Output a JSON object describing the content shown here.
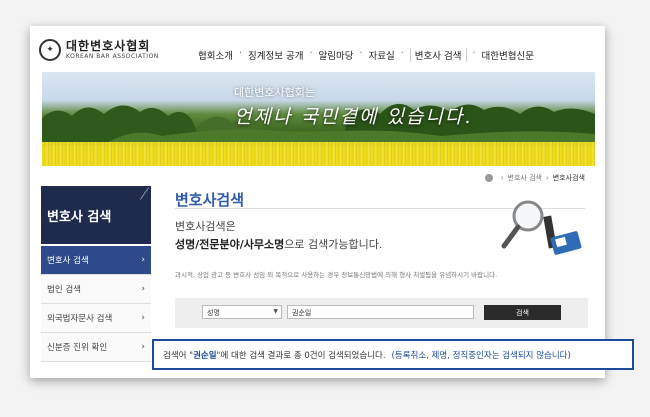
{
  "header": {
    "logo_seal": "✦",
    "logo_ko": "대한변호사협회",
    "logo_en": "KOREAN BAR ASSOCIATION",
    "nav": [
      "협회소개",
      "징계정보 공개",
      "알림마당",
      "자료실",
      "변호사 검색",
      "대한변협신문"
    ]
  },
  "banner": {
    "line1": "대한변호사협회는",
    "line2": "언제나 국민곁에 있습니다."
  },
  "breadcrumb": {
    "parent": "변호사 검색",
    "current": "변호사검색"
  },
  "sidebar": {
    "title": "변호사 검색",
    "items": [
      {
        "label": "변호사 검색",
        "active": true
      },
      {
        "label": "법인 검색",
        "active": false
      },
      {
        "label": "외국법자문사 검색",
        "active": false
      },
      {
        "label": "신분증 진위 확인",
        "active": false
      }
    ]
  },
  "content": {
    "title": "변호사검색",
    "intro_line1": "변호사검색은",
    "intro_line2_em": "성명/전문분야/사무소명",
    "intro_line2_rest": "으로 검색가능합니다.",
    "notice": "과시적, 상업 광고 등 변호사 선임 외 목적으로 사용하는 경우 정보통신망법에 의해 형사 처벌됨을 유념하시기 바랍니다."
  },
  "search": {
    "select_value": "성명",
    "input_value": "권순일",
    "button_label": "검색"
  },
  "result": {
    "prefix": "검색어 \"",
    "name": "권순일",
    "suffix": "\"에 대한 검색 결과로 총 0건이 검색되었습니다.",
    "note": "(등록취소, 제명, 정직중인자는 검색되지 않습니다)"
  },
  "colors": {
    "brand_navy": "#1f2b4d",
    "active_blue": "#2e4a8a",
    "title_blue": "#2e5aa8",
    "highlight_border": "#1d4a9a"
  }
}
